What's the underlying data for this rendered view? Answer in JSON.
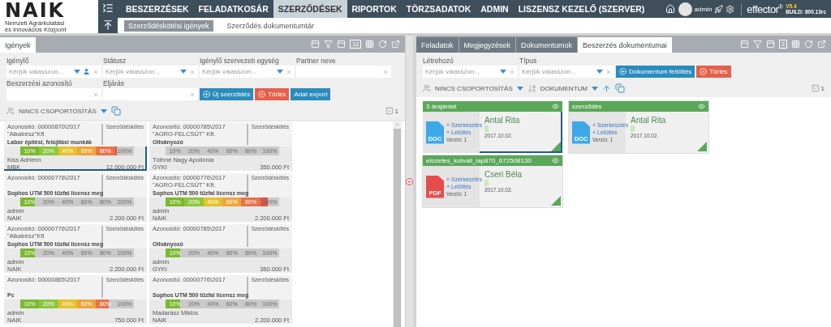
{
  "header": {
    "logo": {
      "name": "NAIK",
      "subtitle_1": "Nemzeti Agrárkutatási",
      "subtitle_2": "és Innovációs Központ"
    },
    "menu": [
      {
        "label": "BESZERZÉSEK",
        "selected": false
      },
      {
        "label": "FELADATKOSÁR",
        "selected": false
      },
      {
        "label": "SZERZŐDÉSEK",
        "selected": true
      },
      {
        "label": "RIPORTOK",
        "selected": false
      },
      {
        "label": "TÖRZSADATOK",
        "selected": false
      },
      {
        "label": "ADMIN",
        "selected": false
      },
      {
        "label": "LISZENSZ KEZELŐ (SZERVER)",
        "selected": false
      }
    ],
    "submenu": [
      {
        "label": "Szerződéskötési igények",
        "selected": true
      },
      {
        "label": "Szerződés dokumentumtár",
        "selected": false
      }
    ],
    "user": "admin",
    "product": {
      "name": "effector$^{®}$",
      "version": "V5.4",
      "build": "BUILD: 800.13rc"
    }
  },
  "left_panel": {
    "tabs": [
      {
        "label": "Igények",
        "selected": true
      }
    ],
    "toolbar_count": "13",
    "filters": [
      {
        "label": "Igénylő",
        "placeholder": "Kérjük válasszon...",
        "kind": "person"
      },
      {
        "label": "Státusz",
        "placeholder": "Kérjük válasszon...",
        "kind": "select"
      },
      {
        "label": "Igénylő szervezeti egység",
        "placeholder": "Kérjük válasszon...",
        "kind": "select"
      },
      {
        "label": "Partner neve",
        "kind": "text"
      },
      {
        "label": "Beszerzési azonosító",
        "kind": "text"
      },
      {
        "label": "Eljárás",
        "kind": "text"
      }
    ],
    "buttons": [
      {
        "label": "Új szerződés",
        "kind": "add"
      },
      {
        "label": "Törlés",
        "kind": "delete"
      },
      {
        "label": "Adat export",
        "kind": "plain"
      }
    ],
    "grouping": "NINCS CSOPORTOSÍTÁS",
    "selected_count": "1",
    "cards": [
      {
        "id": "Azonosító: 00000870\\2017",
        "type": "Szerződéskötés",
        "partner": "\"Alkatrész\"Kft",
        "subject": "Labor építési, felújítási munkák",
        "requester": "Kiss Adrienn",
        "unit": "MBK",
        "amount": "12.000.000 Ft",
        "level": 0.85,
        "selected": true,
        "stages": [
          "10%",
          "20%",
          "40%",
          "60%",
          "80%",
          "100%"
        ]
      },
      {
        "id": "Azonosító: 00000785\\2017",
        "type": "Szerződéskötés",
        "partner": "\"AGRO-FELCSÚT\" Kft.",
        "subject": "Oltványozó",
        "requester": "Tóthné Nagy Apollónia",
        "unit": "GYKI",
        "amount": "350.000 Ft",
        "selected": false,
        "stages": [
          "10%",
          "20%",
          "40%",
          "60%",
          "80%",
          "100%"
        ]
      },
      {
        "id": "Azonosító: 00000776\\2017",
        "type": "Szerződéskötés",
        "subject": "Sophos UTM 500 tűzfal licensz meg",
        "requester": "admin",
        "unit": "NAIK",
        "amount": "2.200.000 Ft",
        "level": 0.13,
        "selected": false,
        "stages": [
          "10%",
          "20%",
          "40%",
          "60%",
          "80%",
          "100%"
        ]
      },
      {
        "id": "Azonosító: 00000776\\2017",
        "type": "Szerződéskötés",
        "partner": "\"AGRO-FELCSÚT\" Kft.",
        "subject": "Sophos UTM 500 tűzfal licensz meg",
        "requester": "admin",
        "unit": "NAIK",
        "amount": "2.200.000 Ft",
        "level": 0.9,
        "selected": false,
        "stages": [
          "10%",
          "20%",
          "40%",
          "60%",
          "80%",
          "100%"
        ]
      },
      {
        "id": "Azonosító: 00000776\\2017",
        "type": "Szerződéskötés",
        "partner": "\"Alkatrész\"Kft",
        "subject": "Sophos UTM 500 tűzfal licensz meg",
        "requester": "admin",
        "unit": "NAIK",
        "amount": "2.200.000 Ft",
        "level": 0.13,
        "selected": false,
        "stages": [
          "10%",
          "20%",
          "40%",
          "60%",
          "80%",
          "100%"
        ]
      },
      {
        "id": "Azonosító: 00000785\\2017",
        "type": "Szerződéskötés",
        "subject": "Oltványozó",
        "requester": "admin",
        "unit": "GYKI",
        "amount": "350.000 Ft",
        "level": 0.13,
        "selected": false,
        "stages": [
          "10%",
          "20%",
          "40%",
          "60%",
          "80%",
          "100%"
        ]
      },
      {
        "id": "Azonosító: 00000865\\2017",
        "type": "Szerződéskötés",
        "subject": "Pc",
        "requester": "admin",
        "unit": "NAIK",
        "amount": "750.000 Ft",
        "level": 0.78,
        "selected": false,
        "stages": [
          "10%",
          "20%",
          "40%",
          "60%",
          "80%",
          "100%"
        ]
      },
      {
        "id": "Azonosító: 00000776\\2017",
        "type": "Szerződéskötés",
        "subject": "Sophos UTM 500 tűzfal licensz meg",
        "requester": "Madarász Miklós",
        "unit": "NAIK",
        "amount": "2.200.000 Ft",
        "level": 0.13,
        "selected": false,
        "stages": [
          "10%",
          "20%",
          "40%",
          "60%",
          "80%",
          "100%"
        ]
      }
    ]
  },
  "right_panel": {
    "tabs": [
      {
        "label": "Feladatok",
        "selected": false
      },
      {
        "label": "Megjegyzések",
        "selected": false
      },
      {
        "label": "Dokumentumok",
        "selected": false
      },
      {
        "label": "Beszerzés dokumentumai",
        "selected": true
      }
    ],
    "toolbar_count": "3",
    "filters": [
      {
        "label": "Létrehozó",
        "placeholder": "Kérjük válasszon...",
        "kind": "select"
      },
      {
        "label": "Típus",
        "placeholder": "Kérjük válasszon...",
        "kind": "select"
      }
    ],
    "buttons": [
      {
        "label": "Dokumentum feltöltés",
        "kind": "add"
      },
      {
        "label": "Törlés",
        "kind": "delete"
      }
    ],
    "grouping": "NINCS CSOPORTOSÍTÁS",
    "sort": "DOKUMENTUM",
    "selected_count": "1",
    "documents": [
      {
        "title": "3 árajánlat",
        "file_type": "DOC",
        "kind": "doc",
        "edit": "+ Szerkesztés",
        "download": "+ Letöltés",
        "version": "Verzió: 1",
        "author": "Antal Rita",
        "date": "2017.10.02.",
        "selected": true
      },
      {
        "title": "szerződés",
        "file_type": "DOC",
        "kind": "doc",
        "edit": "+ Szerkesztés",
        "download": "+ Letöltés",
        "version": "Verzió: 1",
        "author": "Antal Rita",
        "date": "2017.10.02.",
        "selected": false
      },
      {
        "title": "elozetes_kotvall_lap870_672508130",
        "file_type": "PDF",
        "kind": "pdf",
        "edit": "+ Szerkesztés",
        "download": "+ Letöltés",
        "version": "Verzió: 1",
        "author": "Cseri Béla",
        "date": "2017.10.02.",
        "selected": false
      }
    ]
  }
}
